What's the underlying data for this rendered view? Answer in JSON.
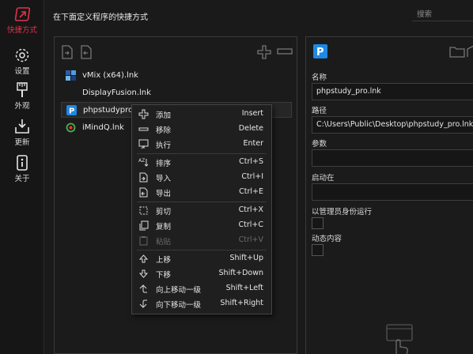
{
  "sidebar": {
    "items": [
      {
        "label": "快捷方式",
        "icon": "shortcut-icon",
        "active": true
      },
      {
        "label": "设置",
        "icon": "gear-icon"
      },
      {
        "label": "外观",
        "icon": "brush-icon"
      },
      {
        "label": "更新",
        "icon": "download-icon"
      },
      {
        "label": "关于",
        "icon": "info-icon"
      }
    ]
  },
  "header": {
    "title": "在下面定义程序的快捷方式",
    "search_placeholder": "搜索"
  },
  "list": {
    "items": [
      {
        "label": "vMix (x64).lnk",
        "icon": "vmix-icon"
      },
      {
        "label": "DisplayFusion.lnk",
        "icon": "displayfusion-icon"
      },
      {
        "label": "phpstudypro",
        "icon": "phpstudy-icon"
      },
      {
        "label": "iMindQ.lnk",
        "icon": "imindq-icon"
      }
    ]
  },
  "context_menu": {
    "items": [
      {
        "label": "添加",
        "shortcut": "Insert",
        "icon": "plus-icon"
      },
      {
        "label": "移除",
        "shortcut": "Delete",
        "icon": "minus-icon"
      },
      {
        "label": "执行",
        "shortcut": "Enter",
        "icon": "run-icon"
      },
      {
        "label": "排序",
        "shortcut": "Ctrl+S",
        "icon": "sort-icon"
      },
      {
        "label": "导入",
        "shortcut": "Ctrl+I",
        "icon": "import-icon"
      },
      {
        "label": "导出",
        "shortcut": "Ctrl+E",
        "icon": "export-icon"
      },
      {
        "label": "剪切",
        "shortcut": "Ctrl+X",
        "icon": "cut-icon"
      },
      {
        "label": "复制",
        "shortcut": "Ctrl+C",
        "icon": "copy-icon"
      },
      {
        "label": "粘贴",
        "shortcut": "Ctrl+V",
        "icon": "paste-icon",
        "disabled": true
      },
      {
        "label": "上移",
        "shortcut": "Shift+Up",
        "icon": "arrow-up-icon"
      },
      {
        "label": "下移",
        "shortcut": "Shift+Down",
        "icon": "arrow-down-icon"
      },
      {
        "label": "向上移动一级",
        "shortcut": "Shift+Left",
        "icon": "move-up-level-icon"
      },
      {
        "label": "向下移动一级",
        "shortcut": "Shift+Right",
        "icon": "move-down-level-icon"
      }
    ]
  },
  "detail": {
    "name_label": "名称",
    "name_value": "phpstudy_pro.lnk",
    "path_label": "路径",
    "path_value": "C:\\Users\\Public\\Desktop\\phpstudy_pro.lnk",
    "params_label": "参数",
    "params_value": "",
    "startin_label": "启动在",
    "startin_value": "",
    "admin_label": "以管理员身份运行",
    "dynamic_label": "动态内容"
  },
  "colors": {
    "accent": "#e0334a",
    "background": "#1a1a1a",
    "border": "#3a3a3a"
  }
}
